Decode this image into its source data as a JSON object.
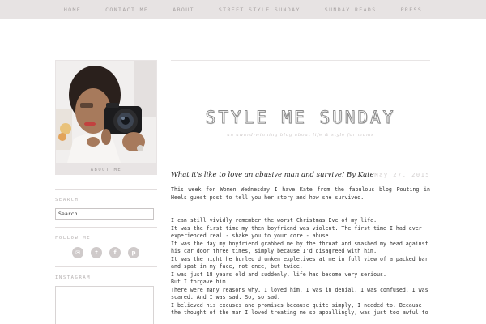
{
  "nav": {
    "items": [
      "HOME",
      "CONTACT ME",
      "ABOUT",
      "STREET STYLE SUNDAY",
      "SUNDAY READS",
      "PRESS"
    ]
  },
  "sidebar": {
    "about_label": "ABOUT ME",
    "search_title": "SEARCH",
    "search_value": "Search...",
    "follow_title": "FOLLOW ME",
    "social_icons": [
      "email-icon",
      "twitter-icon",
      "facebook-icon",
      "pinterest-icon"
    ],
    "instagram_title": "INSTAGRAM"
  },
  "header": {
    "title": "STYLE ME SUNDAY",
    "tagline": "an award-winning blog about life & style for mums"
  },
  "post": {
    "title": "What it's like to love an abusive man and survive! By Kate",
    "date": "May 27, 2015",
    "intro": "This week for Women Wednesday I have Kate from the fabulous blog Pouting in Heels guest post to tell you her story and how she survived.",
    "lines": [
      "I can still vividly remember the worst Christmas Eve of my life.",
      "It was the first time my then boyfriend was violent. The first time I had ever experienced real - shake you to your core - abuse.",
      "It was the day my boyfriend grabbed me by the throat and smashed my head against his car door three times, simply because I'd disagreed with him.",
      "It was the night he hurled drunken expletives at me in full view of a packed bar and spat in my face, not once, but twice.",
      "I was just 18 years old and suddenly, life had become very serious.",
      "But I forgave him.",
      "There were many reasons why. I loved him. I was in denial. I was confused. I was scared. And I was sad. So, so sad.",
      "I believed his excuses and promises because quite simply, I needed to. Because the thought of the man I loved treating me so appallingly, was just too awful to"
    ]
  },
  "colors": {
    "nav_bg": "#e7e3e3",
    "card_bg": "#e8e4e4",
    "accent_text": "#b5b0b0"
  }
}
